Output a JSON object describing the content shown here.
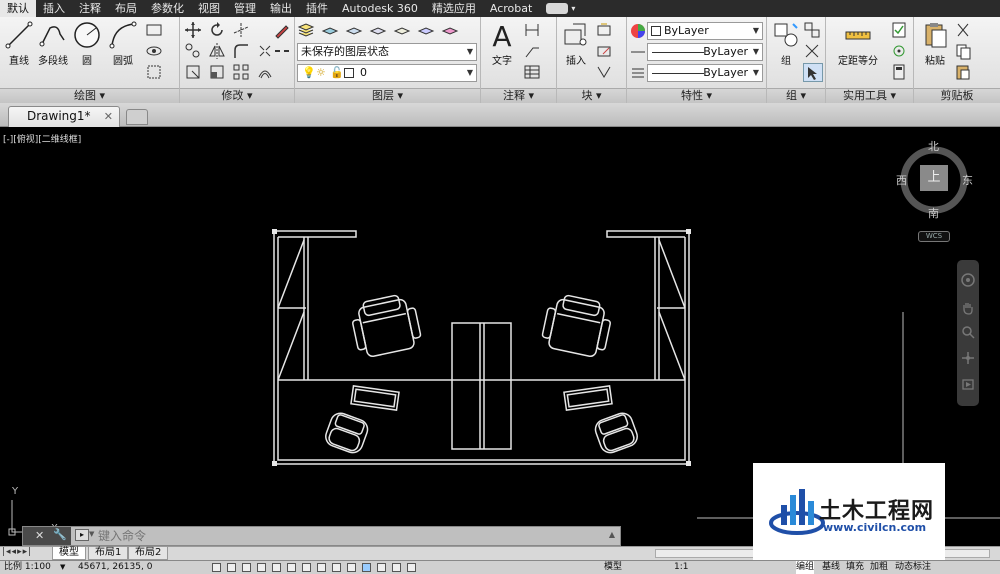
{
  "menu": {
    "tabs": [
      "默认",
      "插入",
      "注释",
      "布局",
      "参数化",
      "视图",
      "管理",
      "输出",
      "插件",
      "Autodesk 360",
      "精选应用",
      "Acrobat"
    ],
    "active_index": 0
  },
  "ribbon": {
    "draw": {
      "title": "绘图",
      "tools": [
        "直线",
        "多段线",
        "圆",
        "圆弧"
      ]
    },
    "modify": {
      "title": "修改"
    },
    "layers": {
      "title": "图层",
      "layer_state": "未保存的图层状态",
      "current_layer": "0"
    },
    "annotation": {
      "title": "注释",
      "text_tool": "文字"
    },
    "block": {
      "title": "块",
      "insert_tool": "插入"
    },
    "properties": {
      "title": "特性",
      "color": "ByLayer",
      "linetype": "ByLayer",
      "lineweight": "ByLayer"
    },
    "groups": {
      "title": "组",
      "group_tool": "组"
    },
    "utilities": {
      "title": "实用工具",
      "measure_tool": "定距等分"
    },
    "clipboard": {
      "title": "剪贴板",
      "paste_tool": "粘贴"
    }
  },
  "document": {
    "tab_name": "Drawing1*",
    "viewport_label": "[-][俯视][二维线框]"
  },
  "viewcube": {
    "north": "北",
    "south": "南",
    "east": "东",
    "west": "西",
    "top_face": "上",
    "wcs": "WCS"
  },
  "axis_labels": {
    "y": "Y",
    "x": "X"
  },
  "command": {
    "placeholder": "键入命令"
  },
  "layout_tabs": [
    "模型",
    "布局1",
    "布局2"
  ],
  "status": {
    "scale": "比例 1:100",
    "coords": "45671, 26135, 0",
    "model": "模型",
    "annot_scale": "1:1",
    "right_buttons": [
      "编组",
      "基线",
      "填充",
      "加粗",
      "动态标注"
    ]
  },
  "watermark": {
    "cn_text": "土木工程网",
    "url": "www.civilcn.com"
  },
  "colors": {
    "ribbon_bg": "#e2e2e2",
    "canvas_bg": "#000000",
    "drawing_lines": "#e6e6e6",
    "watermark_blue": "#1f4fa8"
  }
}
